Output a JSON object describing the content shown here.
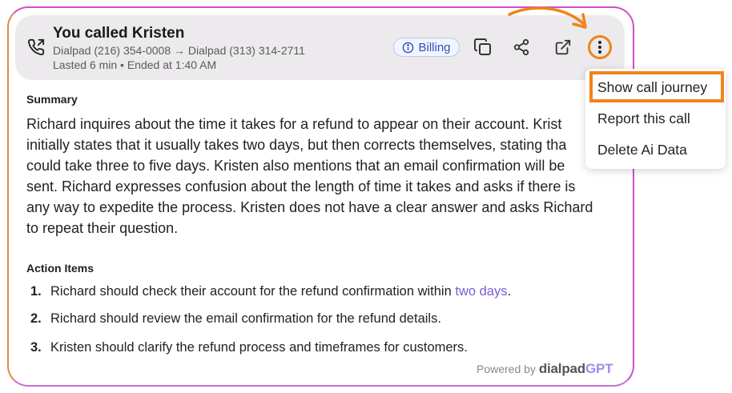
{
  "header": {
    "title": "You called Kristen",
    "route": "Dialpad (216) 354-0008 → Dialpad (313) 314-2711",
    "meta": "Lasted 6 min • Ended at 1:40 AM",
    "badge": "Billing",
    "icons": [
      "phone-outgoing-icon",
      "info-icon",
      "copy-icon",
      "share-icon",
      "external-link-icon",
      "more-vertical-icon"
    ]
  },
  "summary": {
    "label": "Summary",
    "lines": [
      "Richard inquires about the time it takes for a refund to appear on their account. Krist",
      "initially states that it usually takes two days, but then corrects themselves, stating tha",
      "could take three to five days. Kristen also mentions that an email confirmation will be",
      "sent. Richard expresses confusion about the length of time it takes and asks if there is",
      "any way to expedite the process. Kristen does not have a clear answer and asks Richard",
      "to repeat their question."
    ]
  },
  "actions": {
    "label": "Action Items",
    "items": [
      {
        "num": "1.",
        "text": "Richard should check their account for the refund confirmation within ",
        "highlight": "two days",
        "tail": "."
      },
      {
        "num": "2.",
        "text": "Richard should review the email confirmation for the refund details.",
        "highlight": "",
        "tail": ""
      },
      {
        "num": "3.",
        "text": "Kristen should clarify the refund process and timeframes for customers.",
        "highlight": "",
        "tail": ""
      }
    ]
  },
  "footer": {
    "powered": "Powered by",
    "brand_main": "dialpad",
    "brand_gpt": "GPT"
  },
  "menu": {
    "items": [
      "Show call journey",
      "Report this call",
      "Delete Ai Data"
    ]
  },
  "colors": {
    "accent_orange": "#f08418",
    "badge_blue": "#3250b8",
    "highlight_purple": "#7b5cd6",
    "border_magenta": "#d04fd0"
  }
}
